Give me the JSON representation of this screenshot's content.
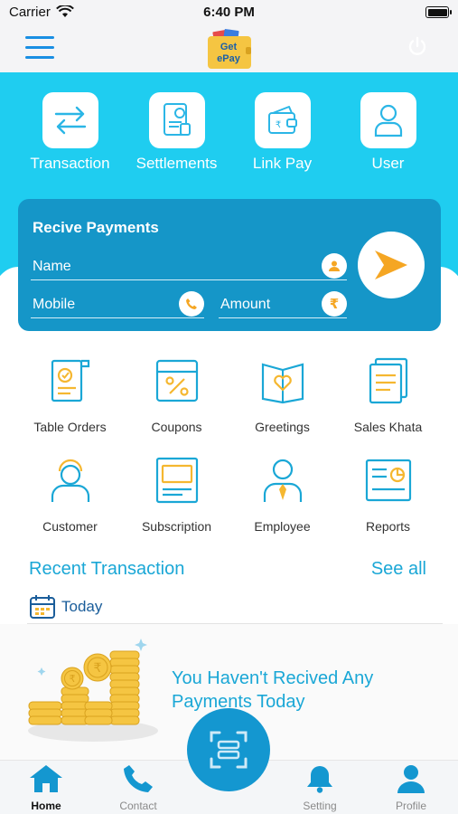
{
  "status_bar": {
    "carrier": "Carrier",
    "time": "6:40 PM"
  },
  "header": {
    "logo_text_line1": "Get",
    "logo_text_line2": "ePay"
  },
  "quick_actions": [
    {
      "label": "Transaction",
      "icon": "swap-arrows-icon"
    },
    {
      "label": "Settlements",
      "icon": "settlement-doc-icon"
    },
    {
      "label": "Link Pay",
      "icon": "wallet-icon"
    },
    {
      "label": "User",
      "icon": "user-icon"
    }
  ],
  "receive_payments": {
    "title": "Recive Payments",
    "name_placeholder": "Name",
    "mobile_placeholder": "Mobile",
    "amount_placeholder": "Amount",
    "currency_symbol": "₹"
  },
  "services": [
    {
      "label": "Table Orders",
      "icon": "table-orders-icon"
    },
    {
      "label": "Coupons",
      "icon": "coupon-icon"
    },
    {
      "label": "Greetings",
      "icon": "greeting-card-icon"
    },
    {
      "label": "Sales Khata",
      "icon": "ledger-icon"
    },
    {
      "label": "Customer",
      "icon": "customer-icon"
    },
    {
      "label": "Subscription",
      "icon": "subscription-icon"
    },
    {
      "label": "Employee",
      "icon": "employee-icon"
    },
    {
      "label": "Reports",
      "icon": "report-icon"
    }
  ],
  "recent": {
    "title": "Recent Transaction",
    "see_all": "See all",
    "today": "Today",
    "empty_message": "You Haven't Recived Any Payments Today"
  },
  "bottom_nav": [
    {
      "label": "Home",
      "active": true
    },
    {
      "label": "Contact",
      "active": false
    },
    {
      "label": "Setting",
      "active": false
    },
    {
      "label": "Profile",
      "active": false
    }
  ],
  "colors": {
    "banner": "#1fcdf0",
    "card": "#1596c8",
    "accent": "#1aa7d6",
    "icon_gold": "#f5b730"
  }
}
